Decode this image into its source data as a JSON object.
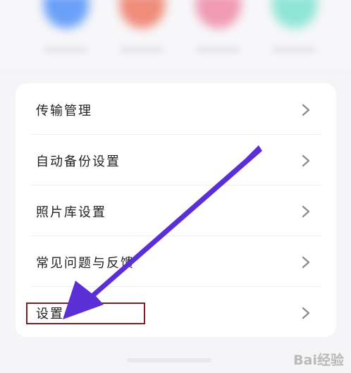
{
  "menu": {
    "items": [
      {
        "label": "传输管理"
      },
      {
        "label": "自动备份设置"
      },
      {
        "label": "照片库设置"
      },
      {
        "label": "常见问题与反馈"
      },
      {
        "label": "设置"
      }
    ]
  },
  "watermark": {
    "text": "Bai经验"
  },
  "colors": {
    "arrow": "#5b2fd6",
    "highlight_border": "#7b1f22",
    "card_background": "#ffffff",
    "page_background": "#f5f5f7"
  }
}
